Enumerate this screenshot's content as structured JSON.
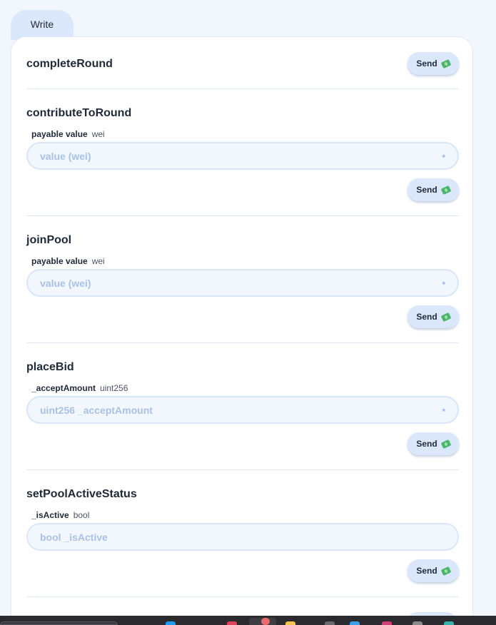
{
  "tab": {
    "label": "Write"
  },
  "functions": [
    {
      "name": "completeRound",
      "send_label": "Send"
    },
    {
      "name": "contributeToRound",
      "param_name": "payable value",
      "param_type": "wei",
      "placeholder": "value (wei)",
      "required_mark": "*",
      "send_label": "Send"
    },
    {
      "name": "joinPool",
      "param_name": "payable value",
      "param_type": "wei",
      "placeholder": "value (wei)",
      "required_mark": "*",
      "send_label": "Send"
    },
    {
      "name": "placeBid",
      "param_name": "_acceptAmount",
      "param_type": "uint256",
      "placeholder": "uint256 _acceptAmount",
      "required_mark": "*",
      "send_label": "Send"
    },
    {
      "name": "setPoolActiveStatus",
      "param_name": "_isActive",
      "param_type": "bool",
      "placeholder": "bool _isActive",
      "send_label": "Send"
    }
  ],
  "icons": {
    "send_icon": "money-with-wings-icon"
  },
  "colors": {
    "accent_bg": "#dbe7fb",
    "page_bg": "#f2f6fd",
    "placeholder": "#a9c1e4"
  }
}
